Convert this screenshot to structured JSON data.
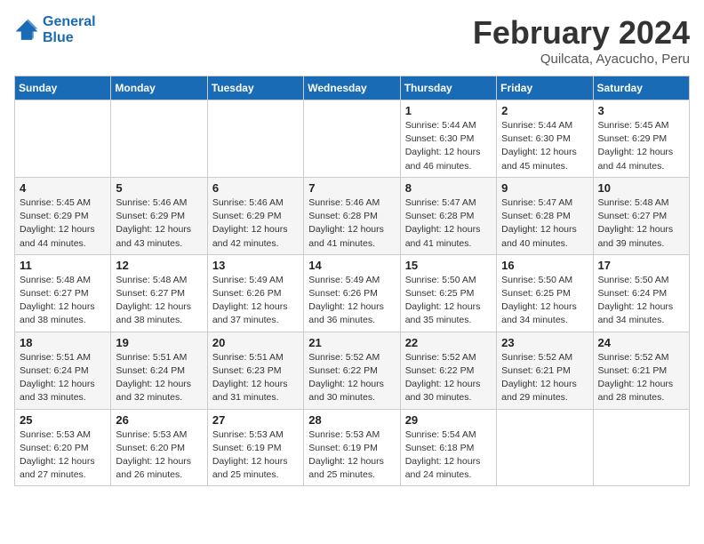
{
  "logo": {
    "line1": "General",
    "line2": "Blue"
  },
  "title": "February 2024",
  "subtitle": "Quilcata, Ayacucho, Peru",
  "headers": [
    "Sunday",
    "Monday",
    "Tuesday",
    "Wednesday",
    "Thursday",
    "Friday",
    "Saturday"
  ],
  "weeks": [
    [
      {
        "day": "",
        "info": ""
      },
      {
        "day": "",
        "info": ""
      },
      {
        "day": "",
        "info": ""
      },
      {
        "day": "",
        "info": ""
      },
      {
        "day": "1",
        "info": "Sunrise: 5:44 AM\nSunset: 6:30 PM\nDaylight: 12 hours\nand 46 minutes."
      },
      {
        "day": "2",
        "info": "Sunrise: 5:44 AM\nSunset: 6:30 PM\nDaylight: 12 hours\nand 45 minutes."
      },
      {
        "day": "3",
        "info": "Sunrise: 5:45 AM\nSunset: 6:29 PM\nDaylight: 12 hours\nand 44 minutes."
      }
    ],
    [
      {
        "day": "4",
        "info": "Sunrise: 5:45 AM\nSunset: 6:29 PM\nDaylight: 12 hours\nand 44 minutes."
      },
      {
        "day": "5",
        "info": "Sunrise: 5:46 AM\nSunset: 6:29 PM\nDaylight: 12 hours\nand 43 minutes."
      },
      {
        "day": "6",
        "info": "Sunrise: 5:46 AM\nSunset: 6:29 PM\nDaylight: 12 hours\nand 42 minutes."
      },
      {
        "day": "7",
        "info": "Sunrise: 5:46 AM\nSunset: 6:28 PM\nDaylight: 12 hours\nand 41 minutes."
      },
      {
        "day": "8",
        "info": "Sunrise: 5:47 AM\nSunset: 6:28 PM\nDaylight: 12 hours\nand 41 minutes."
      },
      {
        "day": "9",
        "info": "Sunrise: 5:47 AM\nSunset: 6:28 PM\nDaylight: 12 hours\nand 40 minutes."
      },
      {
        "day": "10",
        "info": "Sunrise: 5:48 AM\nSunset: 6:27 PM\nDaylight: 12 hours\nand 39 minutes."
      }
    ],
    [
      {
        "day": "11",
        "info": "Sunrise: 5:48 AM\nSunset: 6:27 PM\nDaylight: 12 hours\nand 38 minutes."
      },
      {
        "day": "12",
        "info": "Sunrise: 5:48 AM\nSunset: 6:27 PM\nDaylight: 12 hours\nand 38 minutes."
      },
      {
        "day": "13",
        "info": "Sunrise: 5:49 AM\nSunset: 6:26 PM\nDaylight: 12 hours\nand 37 minutes."
      },
      {
        "day": "14",
        "info": "Sunrise: 5:49 AM\nSunset: 6:26 PM\nDaylight: 12 hours\nand 36 minutes."
      },
      {
        "day": "15",
        "info": "Sunrise: 5:50 AM\nSunset: 6:25 PM\nDaylight: 12 hours\nand 35 minutes."
      },
      {
        "day": "16",
        "info": "Sunrise: 5:50 AM\nSunset: 6:25 PM\nDaylight: 12 hours\nand 34 minutes."
      },
      {
        "day": "17",
        "info": "Sunrise: 5:50 AM\nSunset: 6:24 PM\nDaylight: 12 hours\nand 34 minutes."
      }
    ],
    [
      {
        "day": "18",
        "info": "Sunrise: 5:51 AM\nSunset: 6:24 PM\nDaylight: 12 hours\nand 33 minutes."
      },
      {
        "day": "19",
        "info": "Sunrise: 5:51 AM\nSunset: 6:24 PM\nDaylight: 12 hours\nand 32 minutes."
      },
      {
        "day": "20",
        "info": "Sunrise: 5:51 AM\nSunset: 6:23 PM\nDaylight: 12 hours\nand 31 minutes."
      },
      {
        "day": "21",
        "info": "Sunrise: 5:52 AM\nSunset: 6:22 PM\nDaylight: 12 hours\nand 30 minutes."
      },
      {
        "day": "22",
        "info": "Sunrise: 5:52 AM\nSunset: 6:22 PM\nDaylight: 12 hours\nand 30 minutes."
      },
      {
        "day": "23",
        "info": "Sunrise: 5:52 AM\nSunset: 6:21 PM\nDaylight: 12 hours\nand 29 minutes."
      },
      {
        "day": "24",
        "info": "Sunrise: 5:52 AM\nSunset: 6:21 PM\nDaylight: 12 hours\nand 28 minutes."
      }
    ],
    [
      {
        "day": "25",
        "info": "Sunrise: 5:53 AM\nSunset: 6:20 PM\nDaylight: 12 hours\nand 27 minutes."
      },
      {
        "day": "26",
        "info": "Sunrise: 5:53 AM\nSunset: 6:20 PM\nDaylight: 12 hours\nand 26 minutes."
      },
      {
        "day": "27",
        "info": "Sunrise: 5:53 AM\nSunset: 6:19 PM\nDaylight: 12 hours\nand 25 minutes."
      },
      {
        "day": "28",
        "info": "Sunrise: 5:53 AM\nSunset: 6:19 PM\nDaylight: 12 hours\nand 25 minutes."
      },
      {
        "day": "29",
        "info": "Sunrise: 5:54 AM\nSunset: 6:18 PM\nDaylight: 12 hours\nand 24 minutes."
      },
      {
        "day": "",
        "info": ""
      },
      {
        "day": "",
        "info": ""
      }
    ]
  ]
}
